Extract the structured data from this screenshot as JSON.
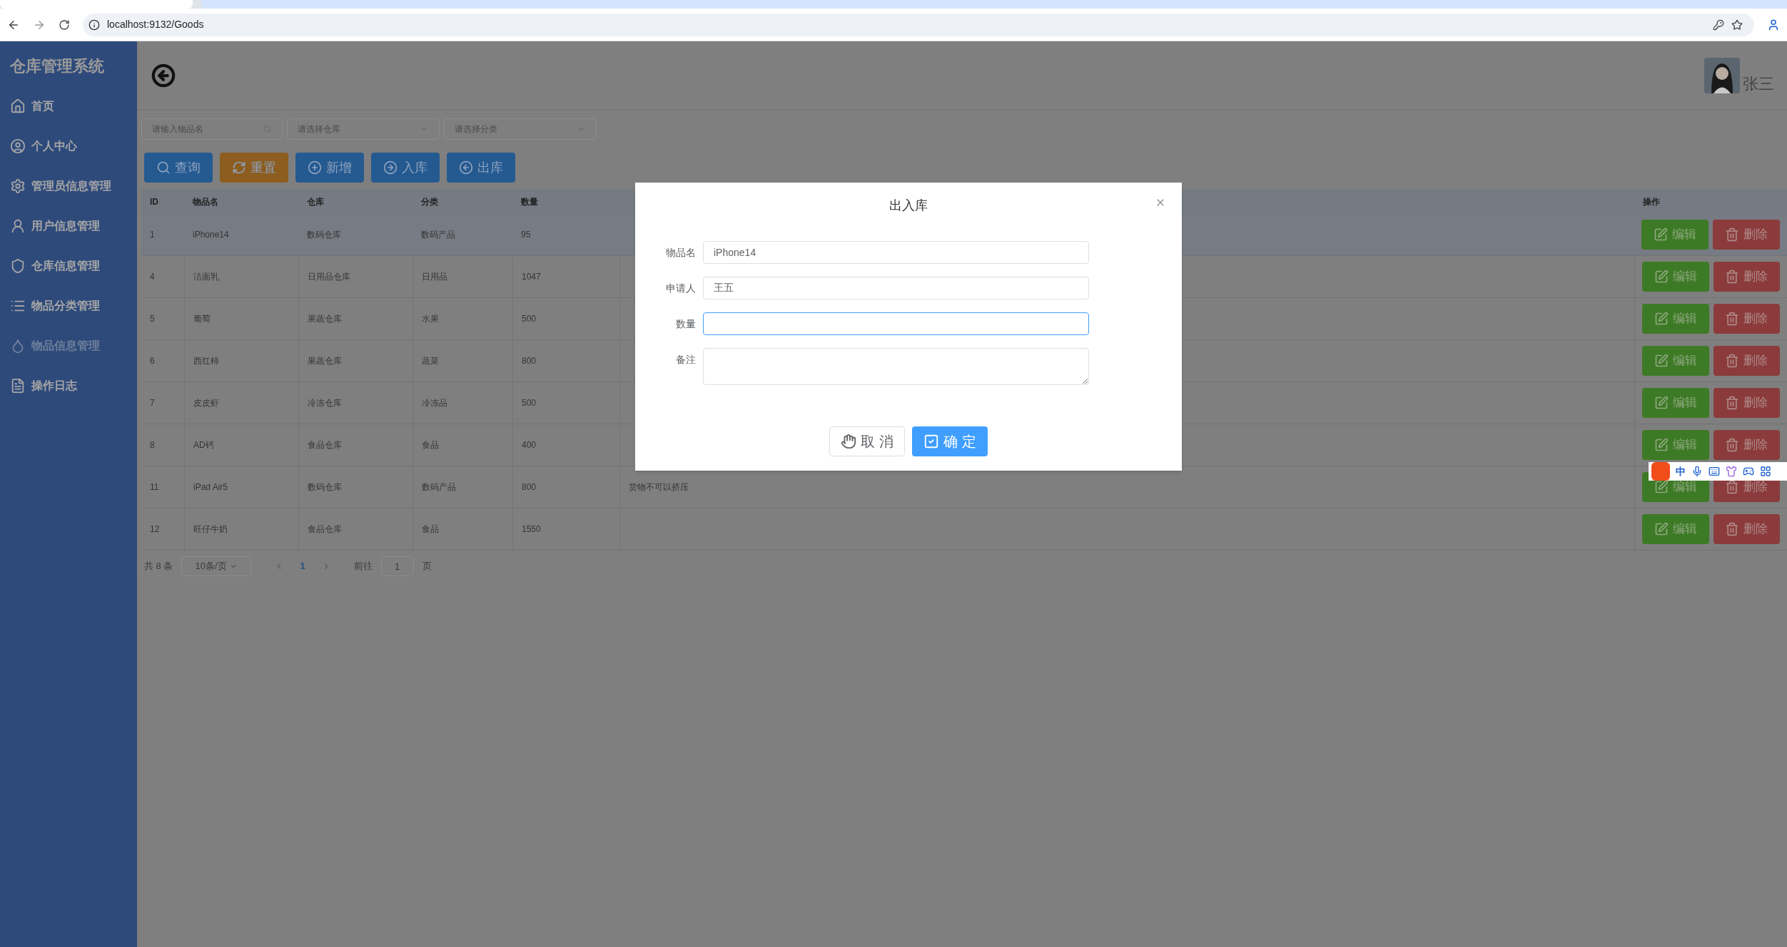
{
  "browser": {
    "url": "localhost:9132/Goods"
  },
  "sidebar": {
    "title": "仓库管理系统",
    "items": [
      {
        "label": "首页",
        "selected": false
      },
      {
        "label": "个人中心",
        "selected": false
      },
      {
        "label": "管理员信息管理",
        "selected": false
      },
      {
        "label": "用户信息管理",
        "selected": false
      },
      {
        "label": "仓库信息管理",
        "selected": false
      },
      {
        "label": "物品分类管理",
        "selected": false
      },
      {
        "label": "物品信息管理",
        "selected": true
      },
      {
        "label": "操作日志",
        "selected": false
      }
    ]
  },
  "header": {
    "user_name": "张三"
  },
  "filters": [
    {
      "kind": "search",
      "placeholder": "请输入物品名"
    },
    {
      "kind": "select",
      "placeholder": "请选择仓库"
    },
    {
      "kind": "select",
      "placeholder": "请选择分类"
    }
  ],
  "toolbar": [
    {
      "label": "查询",
      "kind": "query"
    },
    {
      "label": "重置",
      "kind": "reset"
    },
    {
      "label": "新增",
      "kind": "add"
    },
    {
      "label": "入库",
      "kind": "in"
    },
    {
      "label": "出库",
      "kind": "out"
    }
  ],
  "table": {
    "columns": [
      "ID",
      "物品名",
      "仓库",
      "分类",
      "数量",
      "操作"
    ],
    "rows": [
      {
        "highlighted": true,
        "id": "1",
        "name": "iPhone14",
        "warehouse": "数码仓库",
        "category": "数码产品",
        "quantity": "95",
        "actions": [
          "编辑",
          "删除"
        ]
      },
      {
        "highlighted": false,
        "id": "4",
        "name": "洁面乳",
        "warehouse": "日用品仓库",
        "category": "日用品",
        "quantity": "1047",
        "actions": [
          "编辑",
          "删除"
        ]
      },
      {
        "highlighted": false,
        "id": "5",
        "name": "葡萄",
        "warehouse": "果蔬仓库",
        "category": "水果",
        "quantity": "500",
        "actions": [
          "编辑",
          "删除"
        ]
      },
      {
        "highlighted": false,
        "id": "6",
        "name": "西红柿",
        "warehouse": "果蔬仓库",
        "category": "蔬菜",
        "quantity": "800",
        "actions": [
          "编辑",
          "删除"
        ]
      },
      {
        "highlighted": false,
        "id": "7",
        "name": "皮皮虾",
        "warehouse": "冷冻仓库",
        "category": "冷冻品",
        "quantity": "500",
        "actions": [
          "编辑",
          "删除"
        ]
      },
      {
        "highlighted": false,
        "id": "8",
        "name": "AD钙",
        "warehouse": "食品仓库",
        "category": "食品",
        "quantity": "400",
        "actions": [
          "编辑",
          "删除"
        ]
      },
      {
        "highlighted": false,
        "id": "11",
        "name": "iPad Air5",
        "warehouse": "数码仓库",
        "category": "数码产品",
        "quantity": "800",
        "remark": "货物不可以挤压",
        "actions": [
          "编辑",
          "删除"
        ]
      },
      {
        "highlighted": false,
        "id": "12",
        "name": "旺仔牛奶",
        "warehouse": "食品仓库",
        "category": "食品",
        "quantity": "1550",
        "actions": [
          "编辑",
          "删除"
        ]
      }
    ]
  },
  "pagination": {
    "total": "共 8 条",
    "page_size": "10条/页",
    "pages": [
      {
        "label": "1",
        "selected": true
      }
    ],
    "goto_label": "前往",
    "goto_value": "1",
    "goto_suffix": "页"
  },
  "dialog": {
    "title": "出入库",
    "fields": [
      {
        "label": "物品名",
        "kind": "input",
        "value": "iPhone14",
        "focused": false
      },
      {
        "label": "申请人",
        "kind": "input",
        "value": "王五",
        "focused": false
      },
      {
        "label": "数量",
        "kind": "input",
        "focused": true
      },
      {
        "label": "备注",
        "kind": "textarea",
        "focused": false
      }
    ],
    "buttons": [
      {
        "label": "取 消",
        "kind": "cancel"
      },
      {
        "label": "确 定",
        "kind": "confirm"
      }
    ]
  },
  "ime": {
    "label": "中"
  }
}
